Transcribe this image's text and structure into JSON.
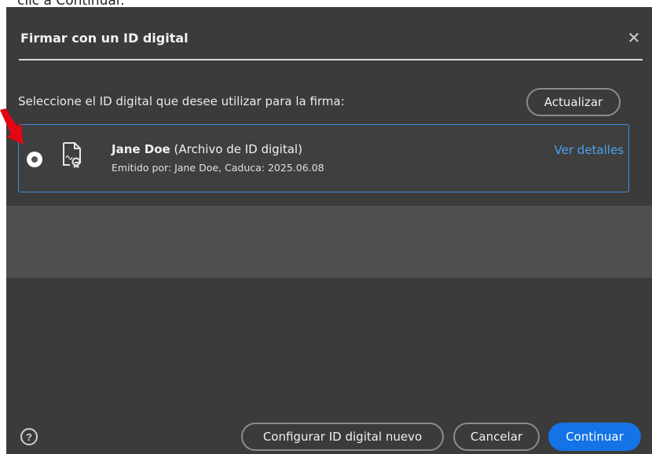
{
  "caption": "clic a Continuar.",
  "dialog": {
    "title": "Firmar con un ID digital",
    "prompt": "Seleccione el ID digital que desee utilizar para la firma:",
    "refresh_label": "Actualizar",
    "digital_id": {
      "name": "Jane Doe",
      "type": "(Archivo de ID digital)",
      "issued": "Emitido por: Jane Doe, Caduca: 2025.06.08",
      "details_link": "Ver detalles"
    },
    "footer": {
      "help_label": "?",
      "configure_label": "Configurar ID digital nuevo",
      "cancel_label": "Cancelar",
      "continue_label": "Continuar"
    }
  },
  "colors": {
    "dialog_bg": "#3b3b3b",
    "accent": "#1473e6",
    "link": "#4aa3f0",
    "selection_border": "#3d8ce6",
    "annotation_arrow": "#e30613"
  },
  "icons": [
    "close-icon",
    "certificate-icon",
    "help-icon",
    "annotation-arrow"
  ]
}
